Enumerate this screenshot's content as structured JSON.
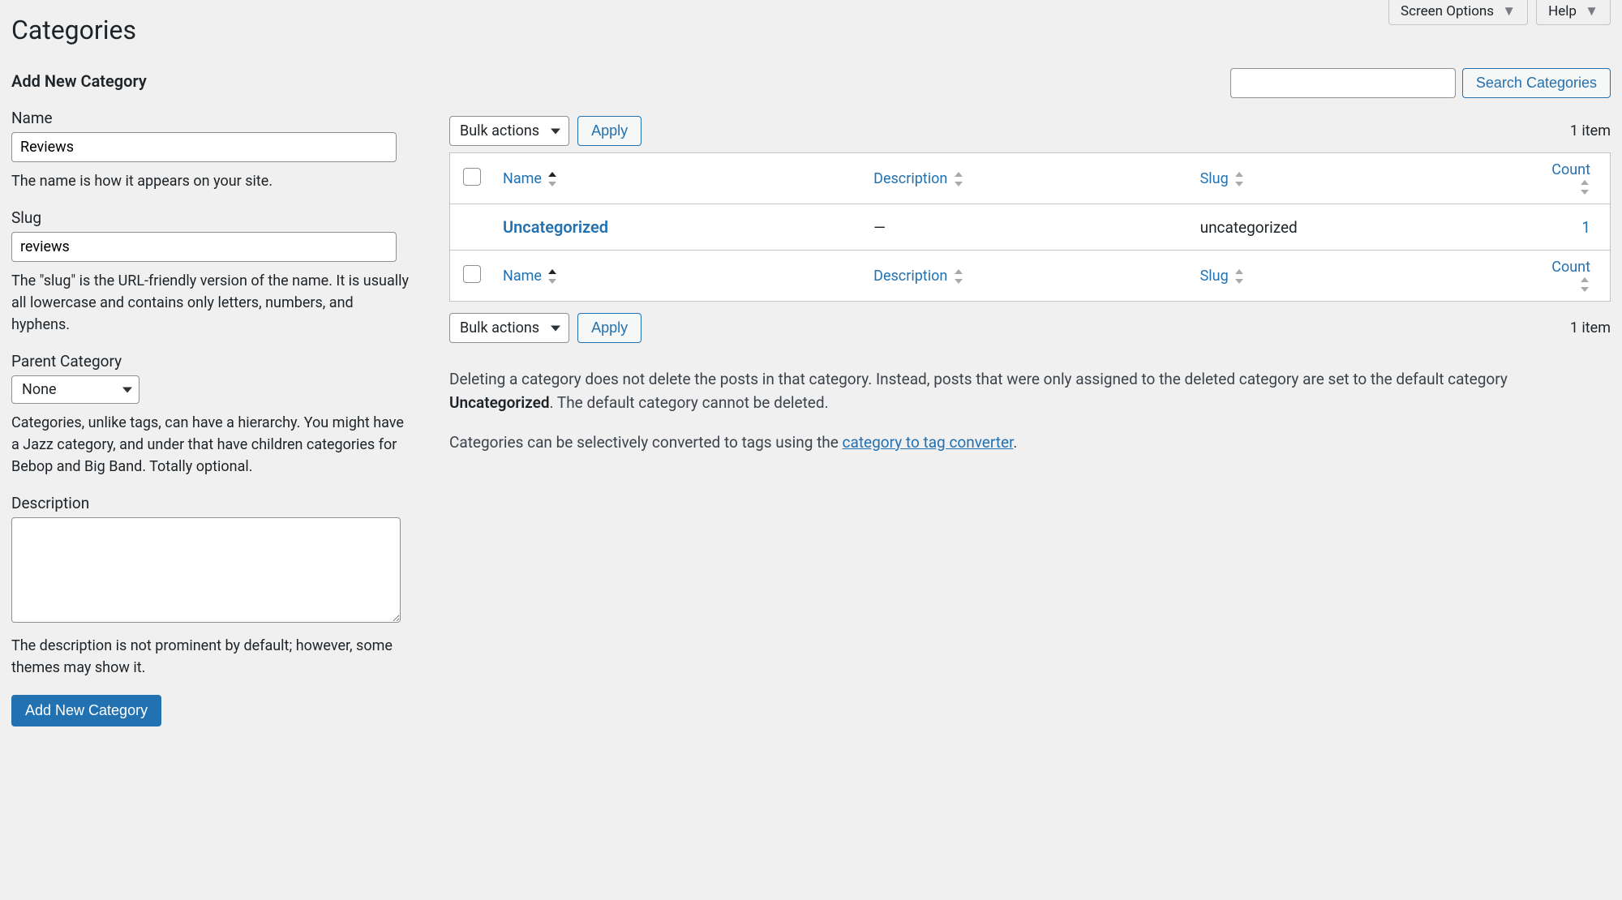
{
  "page": {
    "title": "Categories"
  },
  "tabs": {
    "screen_options": "Screen Options",
    "help": "Help"
  },
  "form": {
    "heading": "Add New Category",
    "name_label": "Name",
    "name_value": "Reviews",
    "name_help": "The name is how it appears on your site.",
    "slug_label": "Slug",
    "slug_value": "reviews",
    "slug_help": "The \"slug\" is the URL-friendly version of the name. It is usually all lowercase and contains only letters, numbers, and hyphens.",
    "parent_label": "Parent Category",
    "parent_value": "None",
    "parent_help": "Categories, unlike tags, can have a hierarchy. You might have a Jazz category, and under that have children categories for Bebop and Big Band. Totally optional.",
    "description_label": "Description",
    "description_value": "",
    "description_help": "The description is not prominent by default; however, some themes may show it.",
    "submit": "Add New Category"
  },
  "search": {
    "button": "Search Categories"
  },
  "bulk": {
    "label": "Bulk actions",
    "apply": "Apply"
  },
  "count_label": "1 item",
  "table": {
    "headers": {
      "name": "Name",
      "description": "Description",
      "slug": "Slug",
      "count": "Count"
    },
    "rows": [
      {
        "name": "Uncategorized",
        "description": "—",
        "slug": "uncategorized",
        "count": "1"
      }
    ]
  },
  "notes": {
    "p1_a": "Deleting a category does not delete the posts in that category. Instead, posts that were only assigned to the deleted category are set to the default category ",
    "p1_strong": "Uncategorized",
    "p1_b": ". The default category cannot be deleted.",
    "p2_a": "Categories can be selectively converted to tags using the ",
    "p2_link": "category to tag converter",
    "p2_b": "."
  }
}
